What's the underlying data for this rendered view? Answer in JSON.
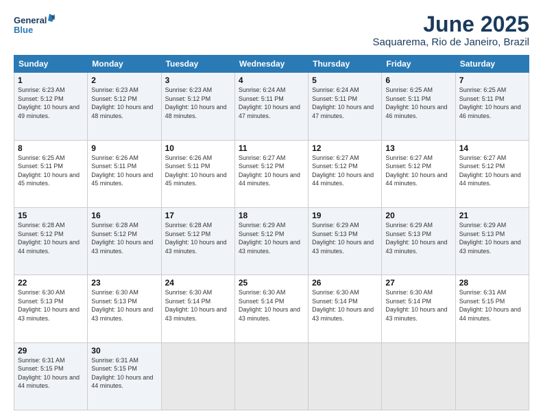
{
  "header": {
    "logo_line1": "General",
    "logo_line2": "Blue",
    "title": "June 2025",
    "subtitle": "Saquarema, Rio de Janeiro, Brazil"
  },
  "weekdays": [
    "Sunday",
    "Monday",
    "Tuesday",
    "Wednesday",
    "Thursday",
    "Friday",
    "Saturday"
  ],
  "weeks": [
    [
      {
        "day": "1",
        "sunrise": "6:23 AM",
        "sunset": "5:12 PM",
        "daylight": "10 hours and 49 minutes."
      },
      {
        "day": "2",
        "sunrise": "6:23 AM",
        "sunset": "5:12 PM",
        "daylight": "10 hours and 48 minutes."
      },
      {
        "day": "3",
        "sunrise": "6:23 AM",
        "sunset": "5:12 PM",
        "daylight": "10 hours and 48 minutes."
      },
      {
        "day": "4",
        "sunrise": "6:24 AM",
        "sunset": "5:11 PM",
        "daylight": "10 hours and 47 minutes."
      },
      {
        "day": "5",
        "sunrise": "6:24 AM",
        "sunset": "5:11 PM",
        "daylight": "10 hours and 47 minutes."
      },
      {
        "day": "6",
        "sunrise": "6:25 AM",
        "sunset": "5:11 PM",
        "daylight": "10 hours and 46 minutes."
      },
      {
        "day": "7",
        "sunrise": "6:25 AM",
        "sunset": "5:11 PM",
        "daylight": "10 hours and 46 minutes."
      }
    ],
    [
      {
        "day": "8",
        "sunrise": "6:25 AM",
        "sunset": "5:11 PM",
        "daylight": "10 hours and 45 minutes."
      },
      {
        "day": "9",
        "sunrise": "6:26 AM",
        "sunset": "5:11 PM",
        "daylight": "10 hours and 45 minutes."
      },
      {
        "day": "10",
        "sunrise": "6:26 AM",
        "sunset": "5:11 PM",
        "daylight": "10 hours and 45 minutes."
      },
      {
        "day": "11",
        "sunrise": "6:27 AM",
        "sunset": "5:12 PM",
        "daylight": "10 hours and 44 minutes."
      },
      {
        "day": "12",
        "sunrise": "6:27 AM",
        "sunset": "5:12 PM",
        "daylight": "10 hours and 44 minutes."
      },
      {
        "day": "13",
        "sunrise": "6:27 AM",
        "sunset": "5:12 PM",
        "daylight": "10 hours and 44 minutes."
      },
      {
        "day": "14",
        "sunrise": "6:27 AM",
        "sunset": "5:12 PM",
        "daylight": "10 hours and 44 minutes."
      }
    ],
    [
      {
        "day": "15",
        "sunrise": "6:28 AM",
        "sunset": "5:12 PM",
        "daylight": "10 hours and 44 minutes."
      },
      {
        "day": "16",
        "sunrise": "6:28 AM",
        "sunset": "5:12 PM",
        "daylight": "10 hours and 43 minutes."
      },
      {
        "day": "17",
        "sunrise": "6:28 AM",
        "sunset": "5:12 PM",
        "daylight": "10 hours and 43 minutes."
      },
      {
        "day": "18",
        "sunrise": "6:29 AM",
        "sunset": "5:12 PM",
        "daylight": "10 hours and 43 minutes."
      },
      {
        "day": "19",
        "sunrise": "6:29 AM",
        "sunset": "5:13 PM",
        "daylight": "10 hours and 43 minutes."
      },
      {
        "day": "20",
        "sunrise": "6:29 AM",
        "sunset": "5:13 PM",
        "daylight": "10 hours and 43 minutes."
      },
      {
        "day": "21",
        "sunrise": "6:29 AM",
        "sunset": "5:13 PM",
        "daylight": "10 hours and 43 minutes."
      }
    ],
    [
      {
        "day": "22",
        "sunrise": "6:30 AM",
        "sunset": "5:13 PM",
        "daylight": "10 hours and 43 minutes."
      },
      {
        "day": "23",
        "sunrise": "6:30 AM",
        "sunset": "5:13 PM",
        "daylight": "10 hours and 43 minutes."
      },
      {
        "day": "24",
        "sunrise": "6:30 AM",
        "sunset": "5:14 PM",
        "daylight": "10 hours and 43 minutes."
      },
      {
        "day": "25",
        "sunrise": "6:30 AM",
        "sunset": "5:14 PM",
        "daylight": "10 hours and 43 minutes."
      },
      {
        "day": "26",
        "sunrise": "6:30 AM",
        "sunset": "5:14 PM",
        "daylight": "10 hours and 43 minutes."
      },
      {
        "day": "27",
        "sunrise": "6:30 AM",
        "sunset": "5:14 PM",
        "daylight": "10 hours and 43 minutes."
      },
      {
        "day": "28",
        "sunrise": "6:31 AM",
        "sunset": "5:15 PM",
        "daylight": "10 hours and 44 minutes."
      }
    ],
    [
      {
        "day": "29",
        "sunrise": "6:31 AM",
        "sunset": "5:15 PM",
        "daylight": "10 hours and 44 minutes."
      },
      {
        "day": "30",
        "sunrise": "6:31 AM",
        "sunset": "5:15 PM",
        "daylight": "10 hours and 44 minutes."
      },
      null,
      null,
      null,
      null,
      null
    ]
  ]
}
